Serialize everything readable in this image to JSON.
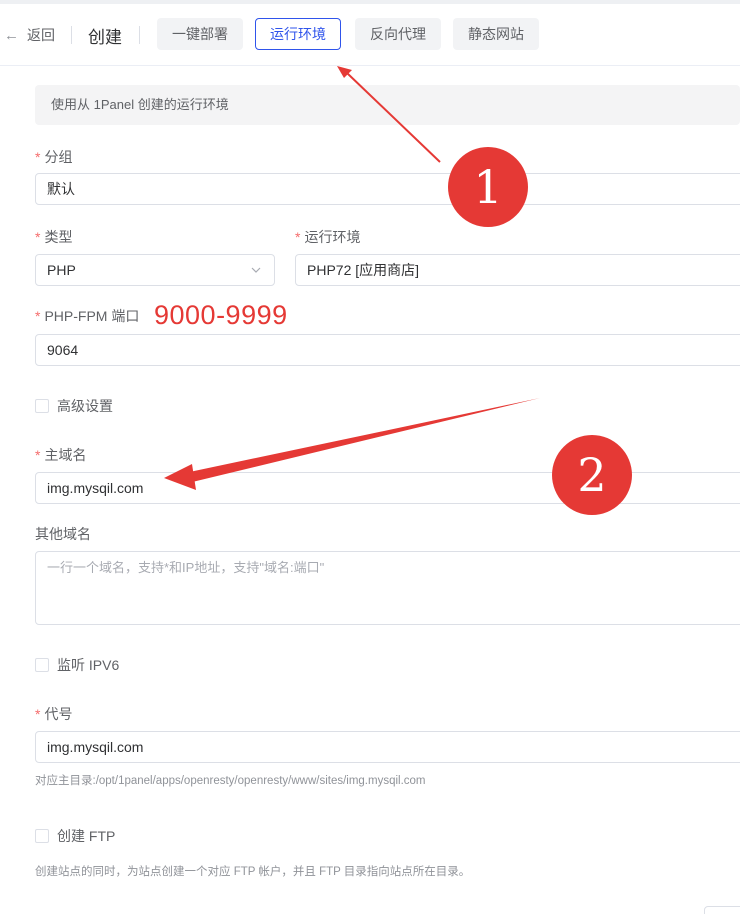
{
  "header": {
    "back_label": "返回",
    "title": "创建",
    "tabs": [
      {
        "label": "一键部署",
        "active": false
      },
      {
        "label": "运行环境",
        "active": true
      },
      {
        "label": "反向代理",
        "active": false
      },
      {
        "label": "静态网站",
        "active": false
      }
    ]
  },
  "notice": "使用从 1Panel 创建的运行环境",
  "form": {
    "group": {
      "label": "分组",
      "value": "默认"
    },
    "type": {
      "label": "类型",
      "value": "PHP"
    },
    "runtime": {
      "label": "运行环境",
      "value": "PHP72 [应用商店]"
    },
    "fpm_port": {
      "label": "PHP-FPM 端口",
      "value": "9064"
    },
    "advanced": {
      "label": "高级设置"
    },
    "primary_domain": {
      "label": "主域名",
      "value": "img.mysqil.com"
    },
    "other_domains": {
      "label": "其他域名",
      "placeholder": "一行一个域名，支持*和IP地址，支持\"域名:端口\""
    },
    "ipv6": {
      "label": "监听 IPV6"
    },
    "alias": {
      "label": "代号",
      "value": "img.mysqil.com",
      "hint": "对应主目录:/opt/1panel/apps/openresty/openresty/www/sites/img.mysqil.com"
    },
    "ftp": {
      "label": "创建 FTP",
      "hint": "创建站点的同时，为站点创建一个对应 FTP 帐户，并且 FTP 目录指向站点所在目录。"
    }
  },
  "annotations": {
    "port_range": "9000-9999",
    "badge1": "1",
    "badge2": "2",
    "color": "#e53935"
  },
  "colors": {
    "accent": "#2f54eb",
    "required": "#f56c6c"
  }
}
